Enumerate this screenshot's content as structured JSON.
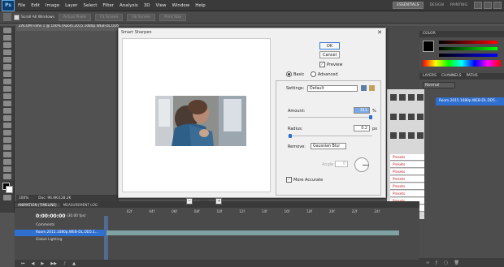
{
  "app": {
    "logo": "Ps"
  },
  "menu": [
    "File",
    "Edit",
    "Image",
    "Layer",
    "Select",
    "Filter",
    "Analysis",
    "3D",
    "View",
    "Window",
    "Help"
  ],
  "workspace": {
    "active": "ESSENTIALS",
    "others": [
      "DESIGN",
      "PAINTING"
    ]
  },
  "options": {
    "scroll_all_windows": "Scroll All Windows",
    "buttons": [
      "Actual Pixels",
      "Fit Screen",
      "Fill Screen",
      "Print Size"
    ]
  },
  "document": {
    "tab": "ZACOM Films 1 @ 100% (Room.2015.1080p.WEB-DL.DD5.1",
    "zoom": "100%",
    "doc_info": "Doc: 96.9K/128.2K"
  },
  "dialog": {
    "title": "Smart Sharpen",
    "ok": "OK",
    "cancel": "Cancel",
    "preview_label": "Preview",
    "basic_label": "Basic",
    "advanced_label": "Advanced",
    "settings_label": "Settings:",
    "settings_value": "Default",
    "amount_label": "Amount:",
    "amount_value": "311",
    "amount_unit": "%",
    "radius_label": "Radius:",
    "radius_value": "0.2",
    "radius_unit": "px",
    "remove_label": "Remove:",
    "remove_value": "Gaussian Blur",
    "angle_label": "Angle:",
    "angle_value": "0",
    "more_accurate_label": "More Accurate",
    "zoom_minus": "−",
    "zoom_value": "100%",
    "zoom_plus": "+"
  },
  "panels": {
    "color_title": "COLOR",
    "swatches_title": "SWATCHES",
    "layers_tabs": [
      "LAYERS",
      "CHANNELS",
      "PATHS"
    ],
    "blend_mode": "Normal",
    "layer_name": "Room.2015.1080p.WEB-DL.DD5..."
  },
  "adjustments": {
    "items": [
      "Presets",
      "Presets",
      "Presets",
      "Presets",
      "Presets",
      "Presets",
      "Presets",
      "Presets"
    ]
  },
  "timeline": {
    "tabs": [
      "ANIMATION (TIMELINE)",
      "MEASUREMENT LOG"
    ],
    "timecode": "0:00:00:00",
    "fps": "(30.00 fps)",
    "ruler": [
      "",
      "02f",
      "04f",
      "06f",
      "08f",
      "10f",
      "12f",
      "14f",
      "16f",
      "18f",
      "20f",
      "22f",
      "24f"
    ],
    "rows": [
      "Comments",
      "Room.2015.1080p.WEB-DL.DD5.1...",
      "Global Lighting"
    ]
  },
  "colors": {
    "accent": "#2f6fcf",
    "ok_border": "#3b7bd6"
  }
}
